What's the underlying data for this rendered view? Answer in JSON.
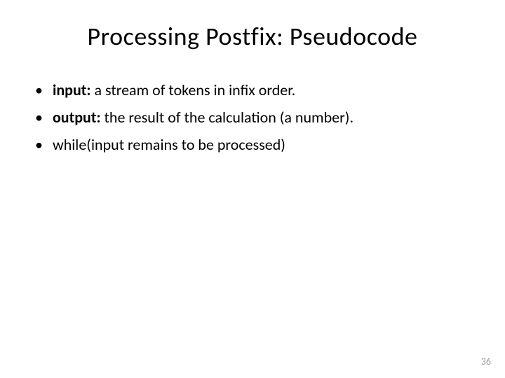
{
  "title": "Processing Postfix: Pseudocode",
  "bullets": [
    {
      "label": "input:",
      "text": " a stream of tokens in infix order."
    },
    {
      "label": "output:",
      "text": " the result of the calculation (a number)."
    },
    {
      "label": "",
      "text": "while(input remains to be processed)"
    }
  ],
  "pageNumber": "36"
}
